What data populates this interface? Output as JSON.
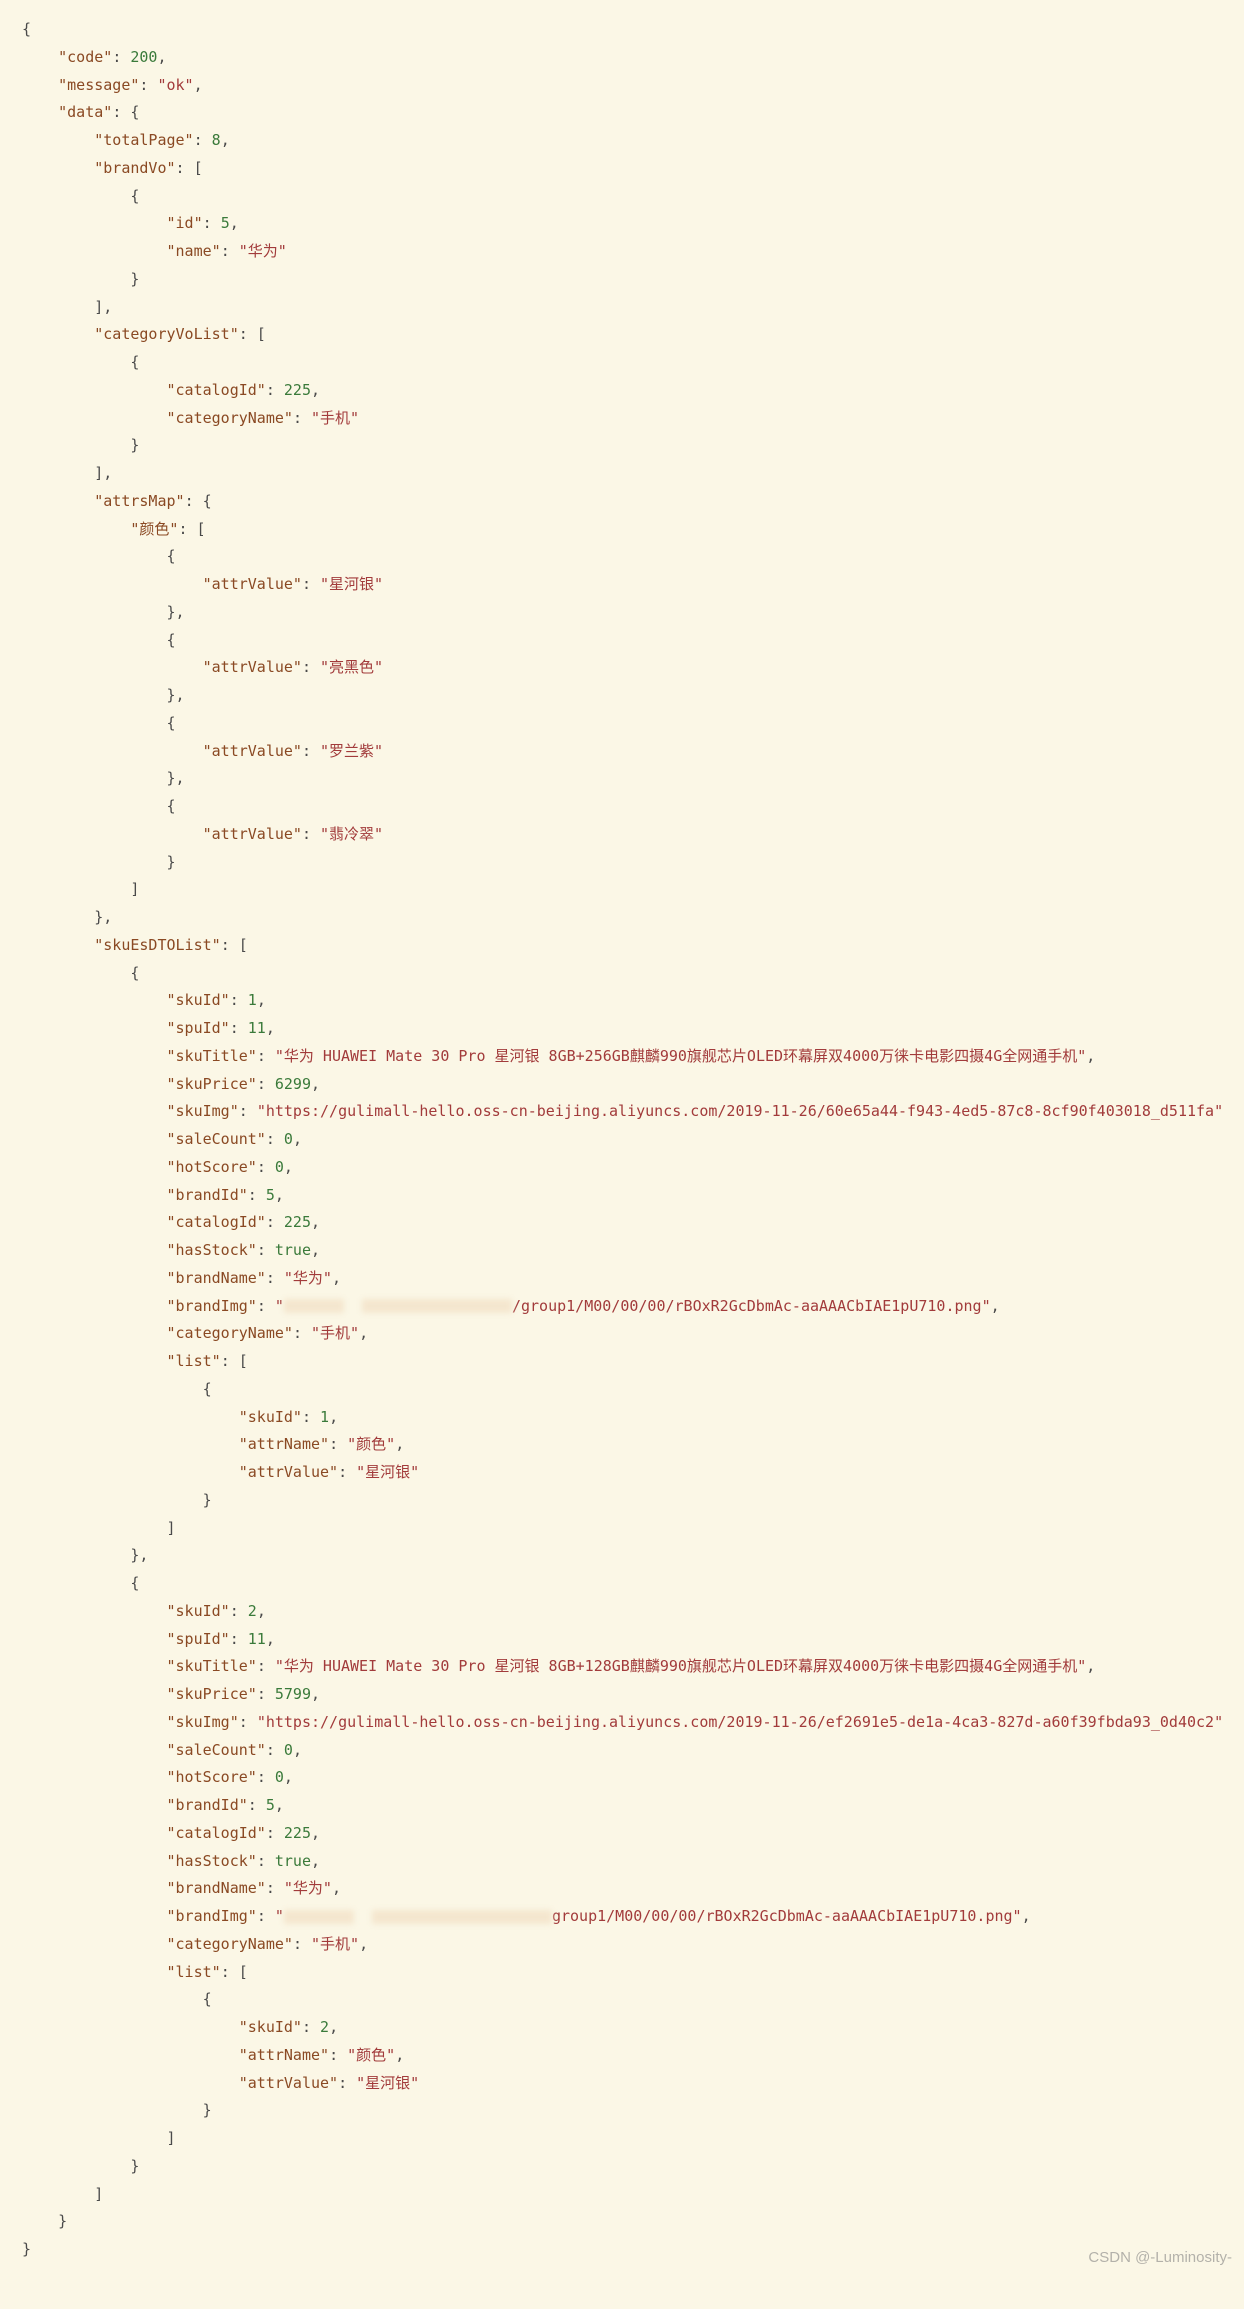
{
  "watermark": "CSDN @-Luminosity-",
  "json": {
    "code": 200,
    "message": "ok",
    "data": {
      "totalPage": 8,
      "brandVo": [
        {
          "id": 5,
          "name": "华为"
        }
      ],
      "categoryVoList": [
        {
          "catalogId": 225,
          "categoryName": "手机"
        }
      ],
      "attrsMap": {
        "颜色": [
          {
            "attrValue": "星河银"
          },
          {
            "attrValue": "亮黑色"
          },
          {
            "attrValue": "罗兰紫"
          },
          {
            "attrValue": "翡冷翠"
          }
        ]
      },
      "skuEsDTOList": [
        {
          "skuId": 1,
          "spuId": 11,
          "skuTitle": "华为 HUAWEI Mate 30 Pro 星河银 8GB+256GB麒麟990旗舰芯片OLED环幕屏双4000万徕卡电影四摄4G全网通手机",
          "skuPrice": 6299,
          "skuImg": "https://gulimall-hello.oss-cn-beijing.aliyuncs.com/2019-11-26/60e65a44-f943-4ed5-87c8-8cf90f403018_d511fa",
          "saleCount": 0,
          "hotScore": 0,
          "brandId": 5,
          "catalogId": 225,
          "hasStock": true,
          "brandName": "华为",
          "brandImg_suffix": "/group1/M00/00/00/rBOxR2GcDbmAc-aaAAACbIAE1pU710.png",
          "categoryName": "手机",
          "list": [
            {
              "skuId": 1,
              "attrName": "颜色",
              "attrValue": "星河银"
            }
          ]
        },
        {
          "skuId": 2,
          "spuId": 11,
          "skuTitle": "华为 HUAWEI Mate 30 Pro 星河银 8GB+128GB麒麟990旗舰芯片OLED环幕屏双4000万徕卡电影四摄4G全网通手机",
          "skuPrice": 5799,
          "skuImg": "https://gulimall-hello.oss-cn-beijing.aliyuncs.com/2019-11-26/ef2691e5-de1a-4ca3-827d-a60f39fbda93_0d40c2",
          "saleCount": 0,
          "hotScore": 0,
          "brandId": 5,
          "catalogId": 225,
          "hasStock": true,
          "brandName": "华为",
          "brandImg_suffix": "group1/M00/00/00/rBOxR2GcDbmAc-aaAAACbIAE1pU710.png",
          "categoryName": "手机",
          "list": [
            {
              "skuId": 2,
              "attrName": "颜色",
              "attrValue": "星河银"
            }
          ]
        }
      ]
    }
  }
}
